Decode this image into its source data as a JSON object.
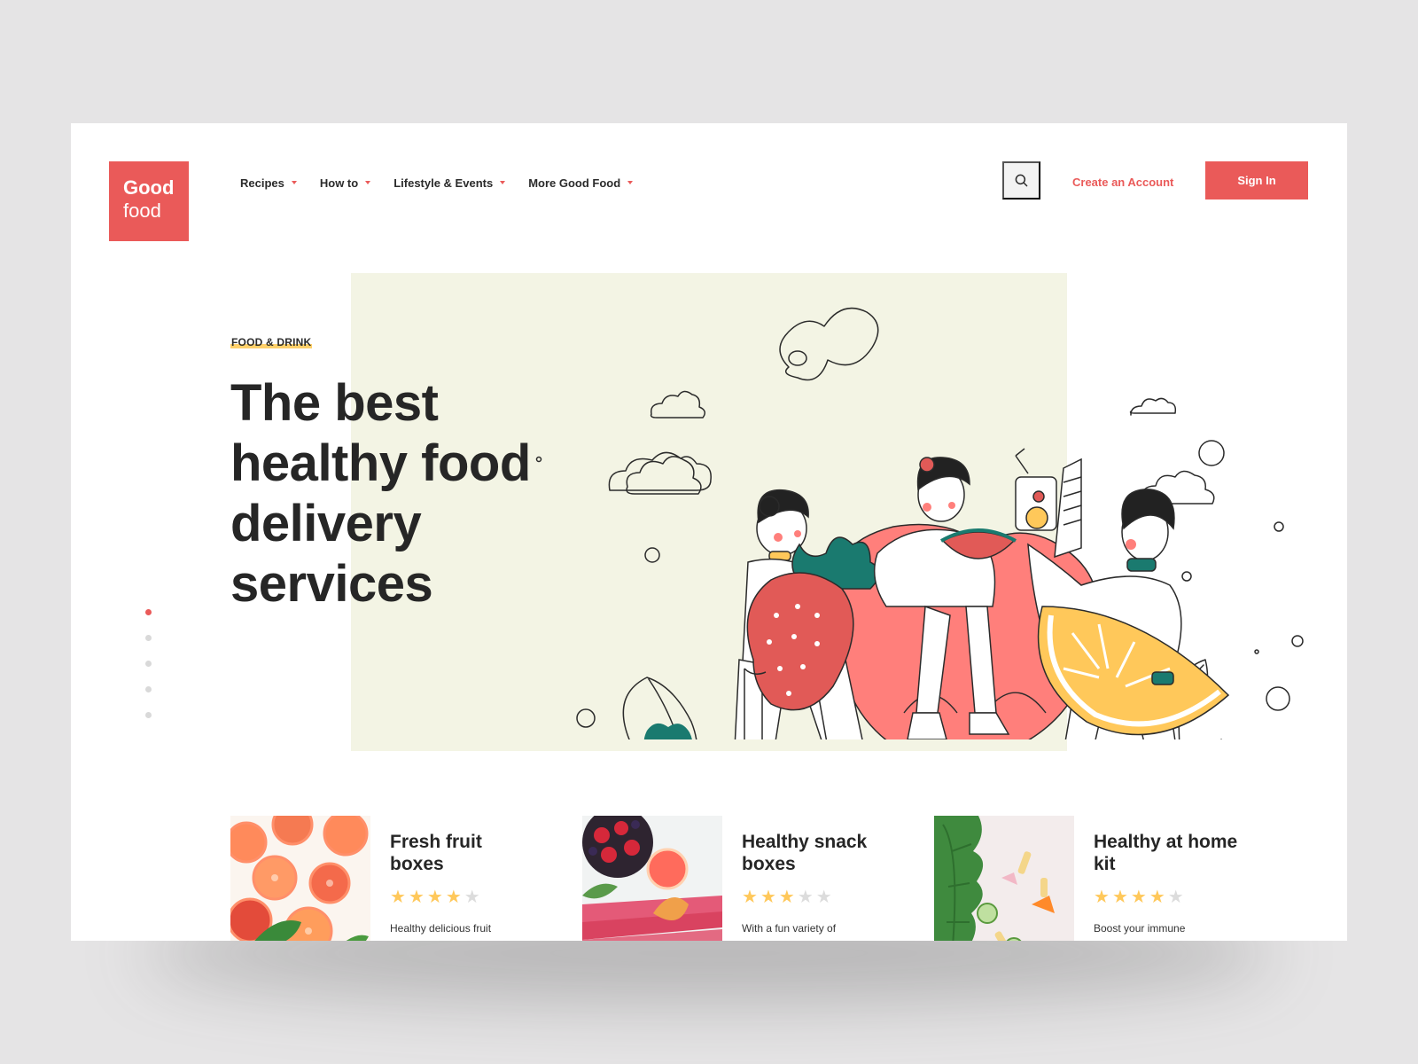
{
  "brand": {
    "line1": "Good",
    "line2": "food",
    "color": "#ea5a59"
  },
  "nav": {
    "items": [
      {
        "label": "Recipes"
      },
      {
        "label": "How to"
      },
      {
        "label": "Lifestyle & Events"
      },
      {
        "label": "More Good Food"
      }
    ]
  },
  "header": {
    "search_icon": "search-icon",
    "create_account_label": "Create an Account",
    "sign_in_label": "Sign In"
  },
  "hero": {
    "category": "FOOD & DRINK",
    "headline": "The best healthy food delivery services",
    "illustration": "people-with-giant-fruits",
    "slides_total": 5,
    "active_slide": 1
  },
  "cards": [
    {
      "title": "Fresh fruit boxes",
      "rating": 4,
      "rating_max": 5,
      "description": "Healthy delicious fruit",
      "image": "citrus-slices-photo"
    },
    {
      "title": "Healthy snack boxes",
      "rating": 3,
      "rating_max": 5,
      "description": "With a fun variety of",
      "image": "berries-rhubarb-photo"
    },
    {
      "title": "Healthy at home kit",
      "rating": 4,
      "rating_max": 5,
      "description": "Boost your immune",
      "image": "kale-cucumber-photo"
    }
  ],
  "colors": {
    "accent": "#ea5a59",
    "hero_bg": "#f3f4e4",
    "highlight": "#ffd06a",
    "star": "#ffc85a",
    "teal": "#1a7a6f"
  }
}
